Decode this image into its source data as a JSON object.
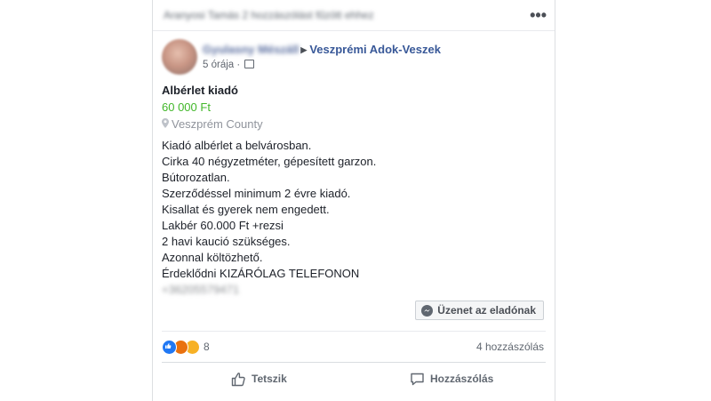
{
  "header": {
    "top_line": "Aranyosi Tamás 2 hozzászólást fűzött ehhez",
    "more_label": "•••"
  },
  "post": {
    "author_name": "Gyulasny Mészáll",
    "group_name": "Veszprémi Adok-Veszek",
    "time": "5 órája",
    "title": "Albérlet kiadó",
    "price": "60 000 Ft",
    "location": "Veszprém County",
    "description": [
      "Kiadó albérlet a belvárosban.",
      "Cirka 40 négyzetméter, gépesített garzon.",
      "Bútorozatlan.",
      "Szerződéssel minimum 2 évre kiadó.",
      "Kisallat és gyerek nem engedett.",
      "Lakbér 60.000 Ft +rezsi",
      "2 havi kaució szükséges.",
      "Azonnal költözhető.",
      "Érdeklődni KIZÁRÓLAG TELEFONON"
    ],
    "phone": "+36205579471",
    "message_button": "Üzenet az eladónak"
  },
  "footer": {
    "reaction_count": "8",
    "comment_count": "4 hozzászólás",
    "like_label": "Tetszik",
    "comment_label": "Hozzászólás"
  },
  "colors": {
    "link": "#385898",
    "price": "#42b72a",
    "like_reaction": "#2078f4",
    "angry_reaction": "#e9710f",
    "sad_reaction": "#f7b125"
  }
}
